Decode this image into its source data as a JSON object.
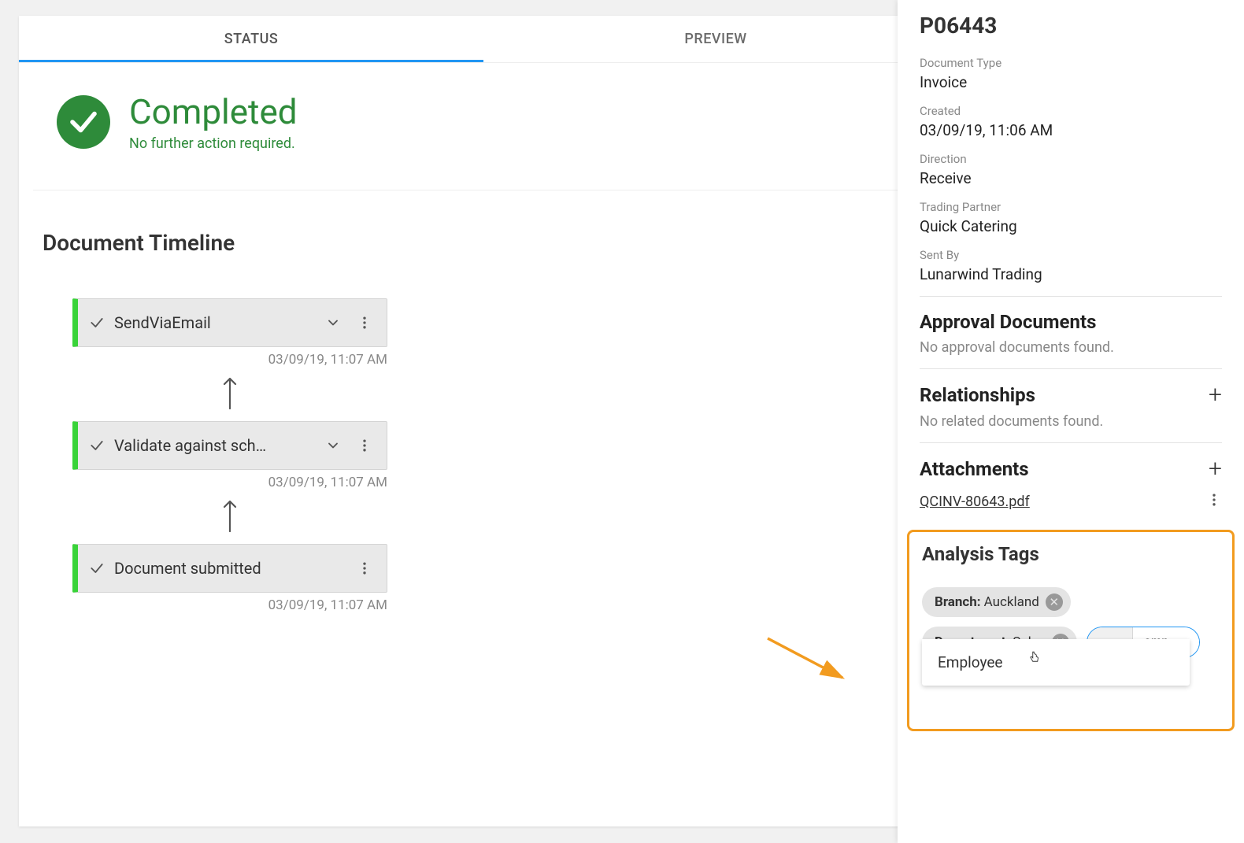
{
  "tabs": {
    "status": "STATUS",
    "preview": "PREVIEW"
  },
  "status": {
    "title": "Completed",
    "subtitle": "No further action required."
  },
  "timeline": {
    "heading": "Document Timeline",
    "items": [
      {
        "label": "SendViaEmail",
        "ts": "03/09/19, 11:07 AM",
        "expandable": true
      },
      {
        "label": "Validate against sch…",
        "ts": "03/09/19, 11:07 AM",
        "expandable": true
      },
      {
        "label": "Document submitted",
        "ts": "03/09/19, 11:07 AM",
        "expandable": false
      }
    ]
  },
  "sidebar": {
    "pid": "P06443",
    "fields": {
      "doc_type": {
        "k": "Document Type",
        "v": "Invoice"
      },
      "created": {
        "k": "Created",
        "v": "03/09/19, 11:06 AM"
      },
      "direction": {
        "k": "Direction",
        "v": "Receive"
      },
      "partner": {
        "k": "Trading Partner",
        "v": "Quick Catering"
      },
      "sent_by": {
        "k": "Sent By",
        "v": "Lunarwind Trading"
      }
    },
    "approval": {
      "heading": "Approval Documents",
      "empty": "No approval documents found."
    },
    "relationships": {
      "heading": "Relationships",
      "empty": "No related documents found."
    },
    "attachments": {
      "heading": "Attachments",
      "file": "QCINV-80643.pdf"
    },
    "analysis": {
      "heading": "Analysis Tags",
      "tags": [
        {
          "key": "Branch:",
          "val": "Auckland"
        },
        {
          "key": "Department:",
          "val": "Sales"
        }
      ],
      "input_value": "emp",
      "suggestion": "Employee"
    }
  },
  "colors": {
    "accent_blue": "#2196f3",
    "status_green": "#2e8b3a",
    "highlight_orange": "#f29b1f"
  }
}
